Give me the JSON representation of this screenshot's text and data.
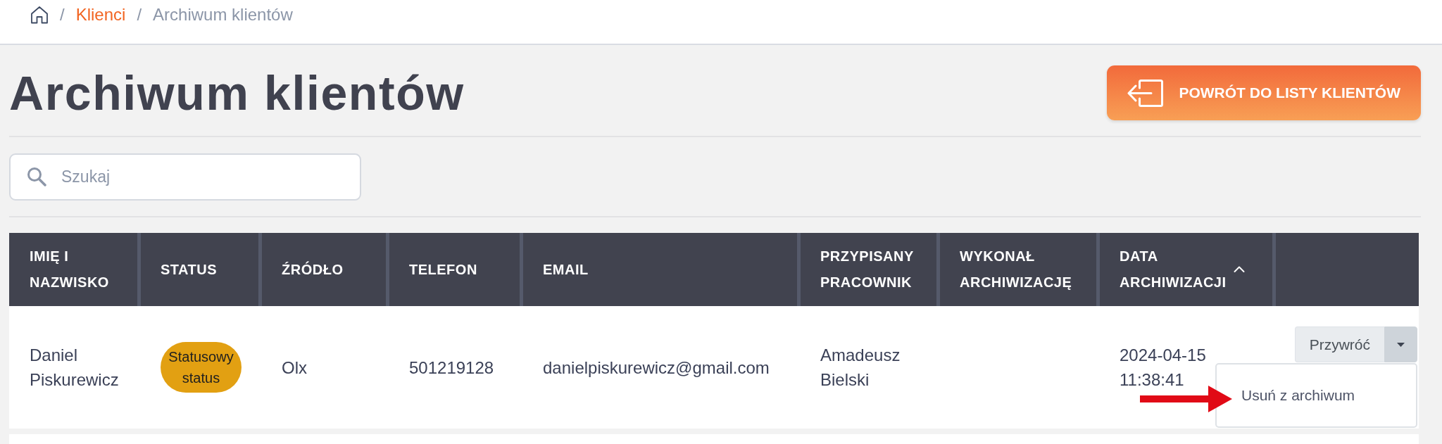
{
  "breadcrumb": {
    "separator": "/",
    "items": [
      {
        "label": "Klienci",
        "kind": "link"
      },
      {
        "label": "Archiwum klientów",
        "kind": "current"
      }
    ]
  },
  "header": {
    "title": "Archiwum klientów",
    "back_button": "POWRÓT DO LISTY KLIENTÓW"
  },
  "search": {
    "placeholder": "Szukaj"
  },
  "table": {
    "columns": [
      {
        "label": "IMIĘ I NAZWISKO"
      },
      {
        "label": "STATUS"
      },
      {
        "label": "ŹRÓDŁO"
      },
      {
        "label": "TELEFON"
      },
      {
        "label": "EMAIL"
      },
      {
        "label": "PRZYPISANY PRACOWNIK"
      },
      {
        "label": "WYKONAŁ ARCHIWIZACJĘ"
      },
      {
        "label": "DATA ARCHIWIZACJI",
        "sorted": true,
        "descending": false
      }
    ],
    "rows": [
      {
        "name": "Daniel Piskurewicz",
        "status": {
          "label": "Statusowy status",
          "color": "#e2a012"
        },
        "source": "Olx",
        "phone": "501219128",
        "email": "danielpiskurewicz@gmail.com",
        "assigned_employee": "Amadeusz Bielski",
        "archived_at": "2024-04-15 11:38:41",
        "actions": {
          "label": "Przywróć",
          "expanded": true,
          "menu": [
            {
              "label": "Usuń z archiwum",
              "marked": true
            }
          ]
        }
      }
    ]
  }
}
